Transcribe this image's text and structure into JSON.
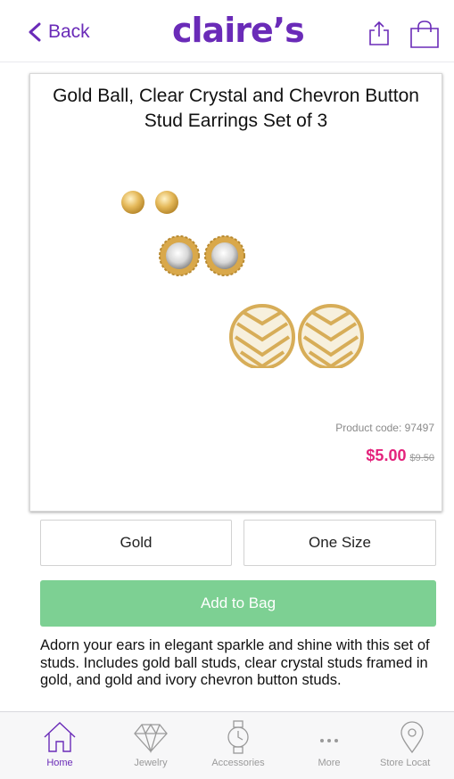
{
  "header": {
    "back_label": "Back",
    "logo_text": "claire’s",
    "share_icon": "share-icon",
    "bag_icon": "shopping-bag-icon",
    "brand_color": "#6a2bb8"
  },
  "product": {
    "title": "Gold Ball, Clear Crystal and Chevron Button Stud Earrings Set of 3",
    "code": "Product code: 97497",
    "price_now": "$5.00",
    "price_old": "$9.50",
    "price_color": "#e4237c"
  },
  "options": {
    "color": "Gold",
    "size": "One Size"
  },
  "cta": {
    "add_label": "Add to Bag",
    "color": "#7dd093"
  },
  "description": "Adorn your ears in elegant sparkle and shine with this set of studs. Includes gold ball studs, clear crystal studs framed in gold, and gold and ivory chevron button studs.",
  "tabbar": {
    "items": [
      {
        "label": "Home",
        "icon": "home-icon"
      },
      {
        "label": "Jewelry",
        "icon": "diamond-icon"
      },
      {
        "label": "Accessories",
        "icon": "watch-icon"
      },
      {
        "label": "More",
        "icon": "more-icon"
      },
      {
        "label": "Store Locat",
        "icon": "location-pin-icon"
      }
    ]
  }
}
